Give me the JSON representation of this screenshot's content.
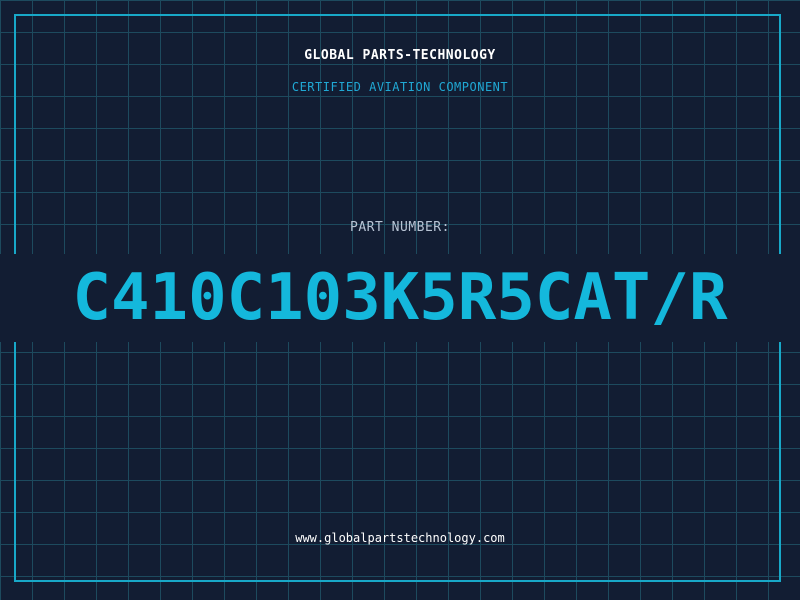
{
  "header": {
    "company": "GLOBAL PARTS-TECHNOLOGY",
    "subtitle": "CERTIFIED AVIATION COMPONENT"
  },
  "part": {
    "label": "PART NUMBER:",
    "number": "C410C103K5R5CAT/R"
  },
  "footer": {
    "website": "www.globalpartstechnology.com"
  },
  "colors": {
    "background": "#121d33",
    "grid": "#1d4a5e",
    "accent": "#14b8dc",
    "text": "#ffffff"
  }
}
